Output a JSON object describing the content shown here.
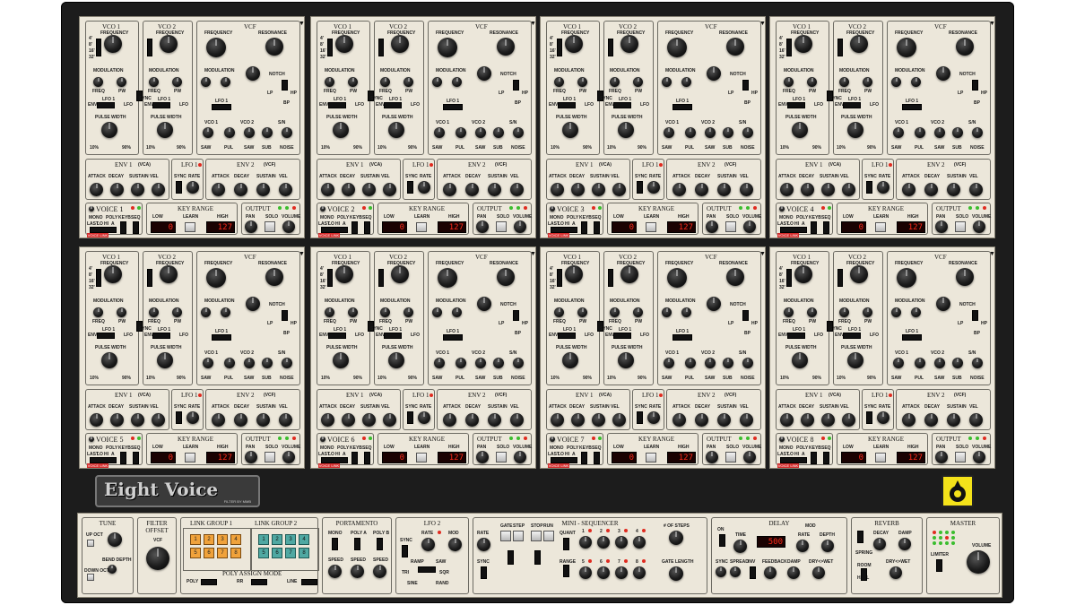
{
  "brand": {
    "name": "Eight Voice",
    "subtitle": "FILTER BY MMB"
  },
  "labels": {
    "vco1": "VCO 1",
    "vco2": "VCO 2",
    "vcf": "VCF",
    "frequency": "FREQUENCY",
    "resonance": "RESONANCE",
    "modulation": "MODULATION",
    "freq": "FREQ",
    "pw": "PW",
    "sync": "SYNC",
    "on": "ON",
    "notch": "NOTCH",
    "lp": "LP",
    "hp": "HP",
    "bp": "BP",
    "lfo1": "LFO 1",
    "env": "ENV",
    "lfo": "LFO",
    "pulse_width": "PULSE WIDTH",
    "pct10": "10%",
    "pct90": "90%",
    "sn": "S/N",
    "saw": "SAW",
    "pul": "PUL",
    "sub": "SUB",
    "noise": "NOISE",
    "env1": "ENV 1",
    "vca": "(VCA)",
    "env2": "ENV 2",
    "vcf_tag": "(VCF)",
    "rate": "RATE",
    "attack": "ATTACK",
    "decay": "DECAY",
    "sustain": "SUSTAIN",
    "vel": "VEL",
    "key_range": "KEY RANGE",
    "low": "LOW",
    "learn": "LEARN",
    "high": "HIGH",
    "output": "OUTPUT",
    "pan": "PAN",
    "solo": "SOLO",
    "volume": "VOLUME",
    "mono": "MONO",
    "poly": "POLY",
    "last": "LAST",
    "lo": "LO",
    "hi": "HI",
    "a": "A",
    "keyb": "KEYB",
    "seq": "SEQ",
    "octaves": [
      "4'",
      "8'",
      "16'",
      "32'"
    ],
    "voice_tag": "VOICE LINK 1"
  },
  "voices": [
    {
      "name": "VOICE 1",
      "low": "0",
      "high": "127"
    },
    {
      "name": "VOICE 2",
      "low": "0",
      "high": "127"
    },
    {
      "name": "VOICE 3",
      "low": "0",
      "high": "127"
    },
    {
      "name": "VOICE 4",
      "low": "0",
      "high": "127"
    },
    {
      "name": "VOICE 5",
      "low": "0",
      "high": "127"
    },
    {
      "name": "VOICE 6",
      "low": "0",
      "high": "127"
    },
    {
      "name": "VOICE 7",
      "low": "0",
      "high": "127"
    },
    {
      "name": "VOICE 8",
      "low": "0",
      "high": "127"
    }
  ],
  "bottom": {
    "tune": {
      "title": "TUNE",
      "up_oct": "UP OCT",
      "bend_depth": "BEND DEPTH",
      "down_oct": "DOWN OCT"
    },
    "filter_offset": {
      "title": "FILTER OFFSET",
      "vcf": "VCF"
    },
    "link_group_1": {
      "title": "LINK GROUP 1",
      "keys": [
        "1",
        "2",
        "3",
        "4",
        "5",
        "6",
        "7",
        "8"
      ]
    },
    "link_group_2": {
      "title": "LINK GROUP 2",
      "keys": [
        "1",
        "2",
        "3",
        "4",
        "5",
        "6",
        "7",
        "8"
      ]
    },
    "poly_assign": {
      "title": "POLY ASSIGN MODE",
      "labels": [
        "POLY",
        "RR",
        "LINE"
      ]
    },
    "portamento": {
      "title": "PORTAMENTO",
      "cols": [
        "MONO",
        "POLY A",
        "POLY B"
      ],
      "speed": "SPEED"
    },
    "lfo2": {
      "title": "LFO 2",
      "sync": "SYNC",
      "rate": "RATE",
      "mod": "MOD",
      "ramp": "RAMP",
      "saw": "SAW",
      "tri": "TRI",
      "sqr": "SQR",
      "sine": "SINE",
      "rand": "RAND"
    },
    "sequencer": {
      "title": "MINI - SEQUENCER",
      "rate": "RATE",
      "gate": "GATE",
      "step": "STEP",
      "stop": "STOP",
      "run": "RUN",
      "quant": "QUANT",
      "sync": "SYNC",
      "num_steps": "# OF STEPS",
      "gate_length": "GATE LENGTH",
      "steps": [
        "1",
        "2",
        "3",
        "4",
        "5",
        "6",
        "7",
        "8"
      ],
      "range": "RANGE"
    },
    "delay": {
      "title": "DELAY",
      "on": "ON",
      "time": "TIME",
      "time_display": "500",
      "sync": "SYNC",
      "spread": "SPREAD",
      "inv": "INV",
      "feedback": "FEEDBACK",
      "damp": "DAMP",
      "dry_wet": "DRY<>WET",
      "rate": "RATE",
      "mod": "MOD",
      "depth": "DEPTH"
    },
    "reverb": {
      "title": "REVERB",
      "decay": "DECAY",
      "damp": "DAMP",
      "spring": "SPRING",
      "room": "ROOM",
      "hall": "HALL",
      "dry_wet": "DRY<>WET"
    },
    "master": {
      "title": "MASTER",
      "limiter": "LIMITER",
      "volume": "VOLUME"
    }
  }
}
